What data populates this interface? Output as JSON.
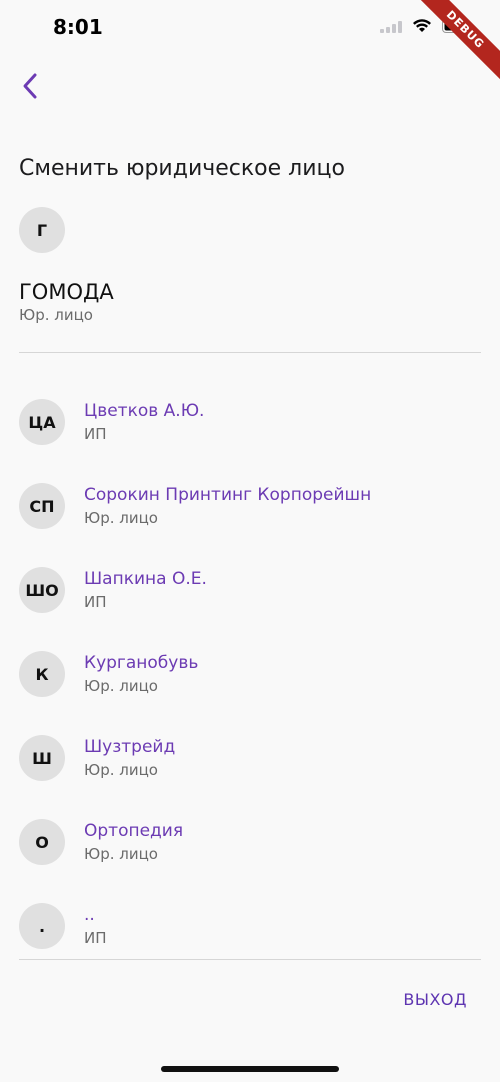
{
  "status_bar": {
    "time": "8:01",
    "debug_label": "DEBUG"
  },
  "header": {
    "back_icon": "chevron-left-icon",
    "title": "Сменить юридическое лицо"
  },
  "current_entity": {
    "initials": "Г",
    "name": "ГОМОДА",
    "type": "Юр. лицо"
  },
  "entities": [
    {
      "initials": "ЦА",
      "name": "Цветков А.Ю.",
      "type": "ИП"
    },
    {
      "initials": "СП",
      "name": "Сорокин Принтинг Корпорейшн",
      "type": "Юр. лицо"
    },
    {
      "initials": "ШО",
      "name": "Шапкина О.Е.",
      "type": "ИП"
    },
    {
      "initials": "К",
      "name": "Курганобувь",
      "type": "Юр. лицо"
    },
    {
      "initials": "Ш",
      "name": "Шузтрейд",
      "type": "Юр. лицо"
    },
    {
      "initials": "О",
      "name": "Ортопедия",
      "type": "Юр. лицо"
    },
    {
      "initials": ".",
      "name": "..",
      "type": "ИП"
    }
  ],
  "footer": {
    "logout_label": "ВЫХОД"
  },
  "colors": {
    "accent": "#6c3bb3",
    "avatar_bg": "#e0e0e0",
    "secondary_text": "#6b6b6b"
  }
}
